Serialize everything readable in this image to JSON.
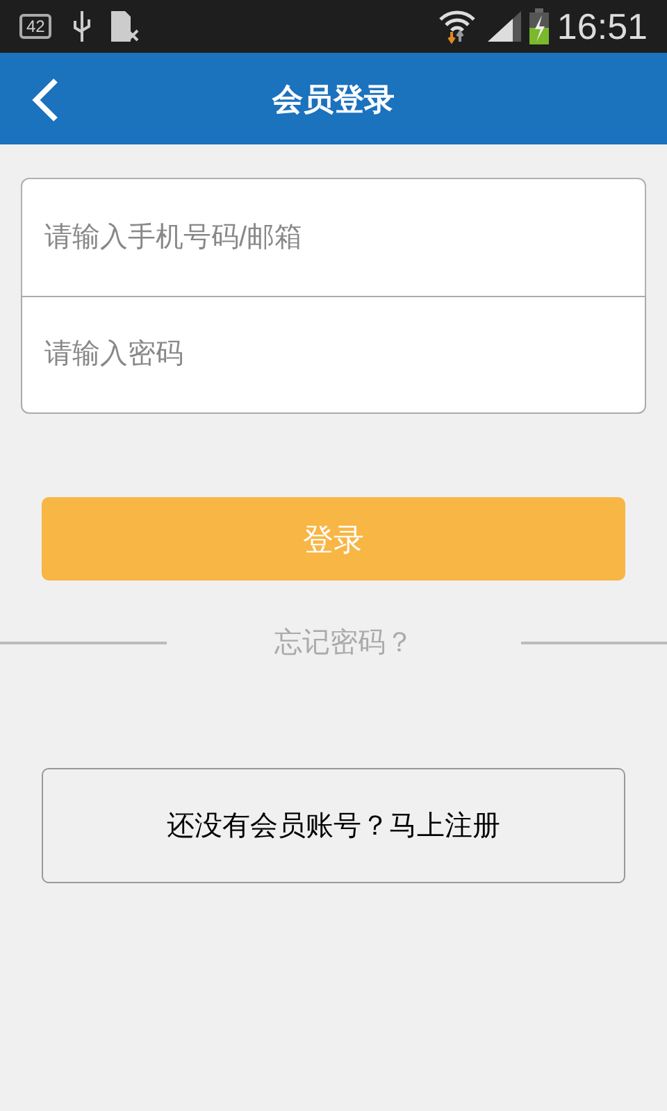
{
  "status_bar": {
    "notification_badge": "42",
    "time": "16:51"
  },
  "header": {
    "title": "会员登录"
  },
  "form": {
    "fields": [
      {
        "placeholder": "请输入手机号码/邮箱"
      },
      {
        "placeholder": "请输入密码"
      }
    ]
  },
  "login_button": "登录",
  "forgot_password": "忘记密码？",
  "register_button": "还没有会员账号？马上注册"
}
